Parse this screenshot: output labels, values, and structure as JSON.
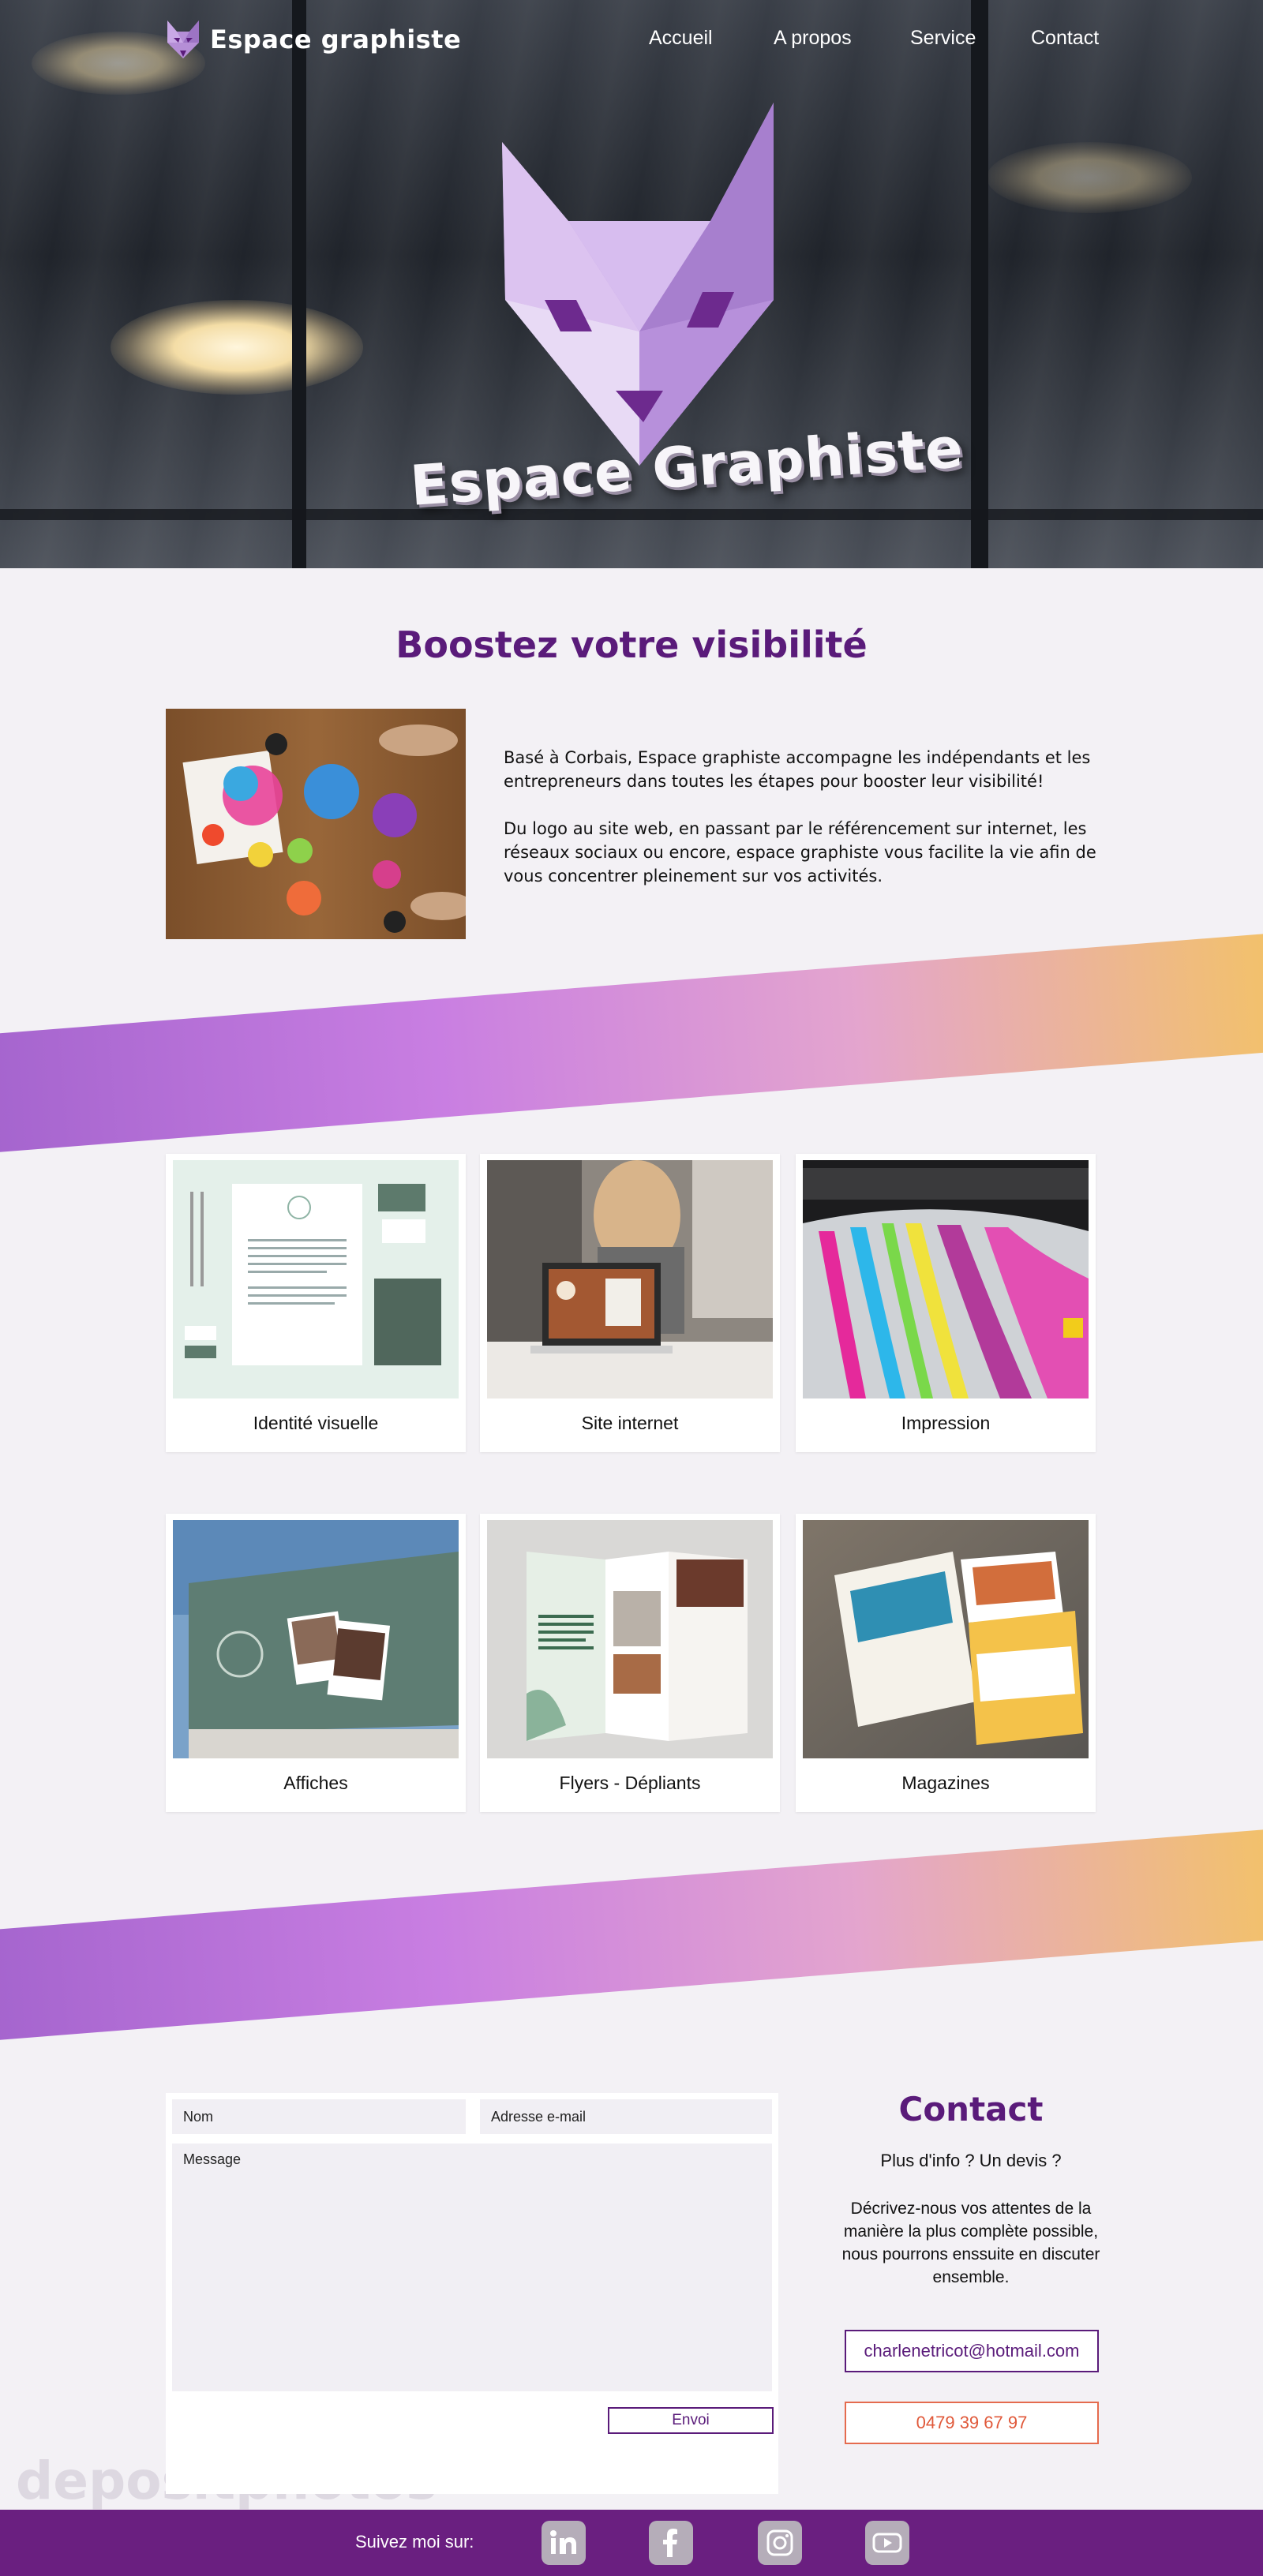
{
  "brand": {
    "name": "Espace graphiste"
  },
  "nav": {
    "items": [
      {
        "label": "Accueil"
      },
      {
        "label": "A propos"
      },
      {
        "label": "Service"
      },
      {
        "label": "Contact"
      }
    ]
  },
  "hero": {
    "logo_text": "Espace Graphiste"
  },
  "intro": {
    "title": "Boostez votre visibilité",
    "paragraphs": [
      "Basé à Corbais, Espace graphiste accompagne les indépendants et les entrepreneurs dans toutes les étapes pour booster leur visibilité!",
      "Du logo au site web, en passant par le référencement sur internet, les réseaux sociaux ou encore, espace graphiste  vous facilite la vie afin de vous concentrer pleinement sur vos activités."
    ]
  },
  "services": [
    {
      "label": "Identité visuelle"
    },
    {
      "label": "Site internet"
    },
    {
      "label": "Impression"
    },
    {
      "label": "Affiches"
    },
    {
      "label": "Flyers - Dépliants"
    },
    {
      "label": "Magazines"
    }
  ],
  "form": {
    "name_placeholder": "Nom",
    "email_placeholder": "Adresse e-mail",
    "message_placeholder": "Message",
    "submit_label": "Envoi"
  },
  "contact": {
    "title": "Contact",
    "subtitle": "Plus d'info ?  Un devis ?",
    "description": "Décrivez-nous vos attentes de la manière la plus complète possible, nous pourrons enssuite en discuter ensemble.",
    "email": "charlenetricot@hotmail.com",
    "phone": "0479 39 67 97"
  },
  "footer": {
    "label": "Suivez moi sur:",
    "socials": [
      {
        "icon": "linkedin-icon"
      },
      {
        "icon": "facebook-icon"
      },
      {
        "icon": "instagram-icon"
      },
      {
        "icon": "youtube-icon"
      }
    ]
  },
  "watermark": {
    "text": "depositphotos"
  },
  "colors": {
    "primary": "#5a1b7a",
    "footer": "#6a1f80",
    "accent_orange": "#e0593a",
    "band_start": "#9b56c9",
    "band_end": "#f5c24d"
  }
}
